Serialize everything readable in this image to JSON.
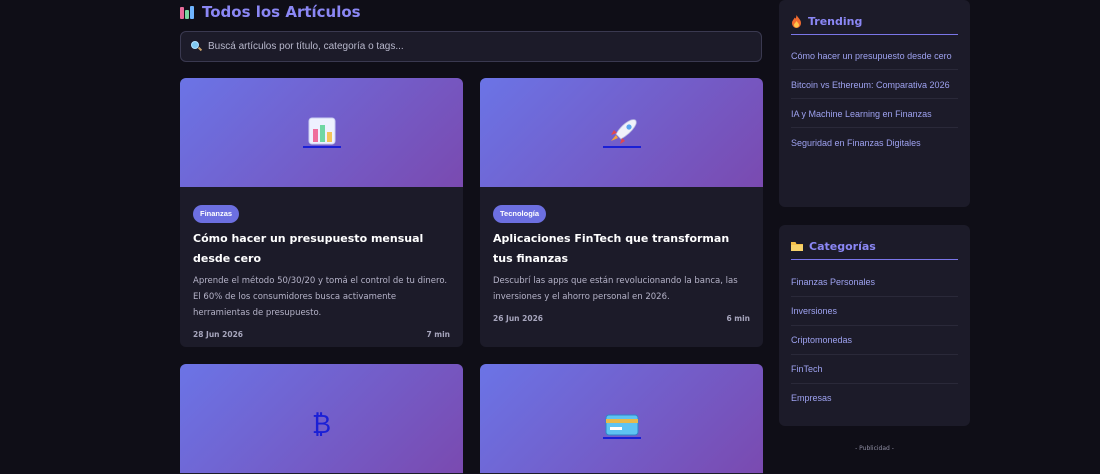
{
  "main": {
    "title": "Todos los Artículos",
    "title_icon": "bar-chart-icon",
    "search": {
      "placeholder": "Buscá artículos por título, categoría o tags...",
      "icon": "magnifier-icon"
    }
  },
  "articles": [
    {
      "icon": "bar-chart-icon",
      "category": "Finanzas",
      "title": "Cómo hacer un presupuesto mensual desde cero",
      "excerpt": "Aprende el método 50/30/20 y tomá el control de tu dinero. El 60% de los consumidores busca activamente herramientas de presupuesto.",
      "date": "28 Jun 2026",
      "read_time": "7 min"
    },
    {
      "icon": "rocket-icon",
      "category": "Tecnología",
      "title": "Aplicaciones FinTech que transforman tus finanzas",
      "excerpt": "Descubrí las apps que están revolucionando la banca, las inversiones y el ahorro personal en 2026.",
      "date": "26 Jun 2026",
      "read_time": "6 min"
    },
    {
      "icon": "bitcoin-icon",
      "glyph": "₿"
    },
    {
      "icon": "credit-card-icon"
    }
  ],
  "sidebar": {
    "trending": {
      "title": "Trending",
      "icon": "fire-icon",
      "items": [
        "Cómo hacer un presupuesto desde cero",
        "Bitcoin vs Ethereum: Comparativa 2026",
        "IA y Machine Learning en Finanzas",
        "Seguridad en Finanzas Digitales"
      ]
    },
    "categories": {
      "title": "Categorías",
      "icon": "folder-icon",
      "items": [
        "Finanzas Personales",
        "Inversiones",
        "Criptomonedas",
        "FinTech",
        "Empresas"
      ]
    },
    "ad_label": "- Publicidad -"
  },
  "colors": {
    "background": "#0f0e17",
    "panel": "#1c1b29",
    "accent": "#8b87f5",
    "tag": "#6c6fe0",
    "hero_start": "#6b74e6",
    "hero_end": "#7a4ab0"
  }
}
